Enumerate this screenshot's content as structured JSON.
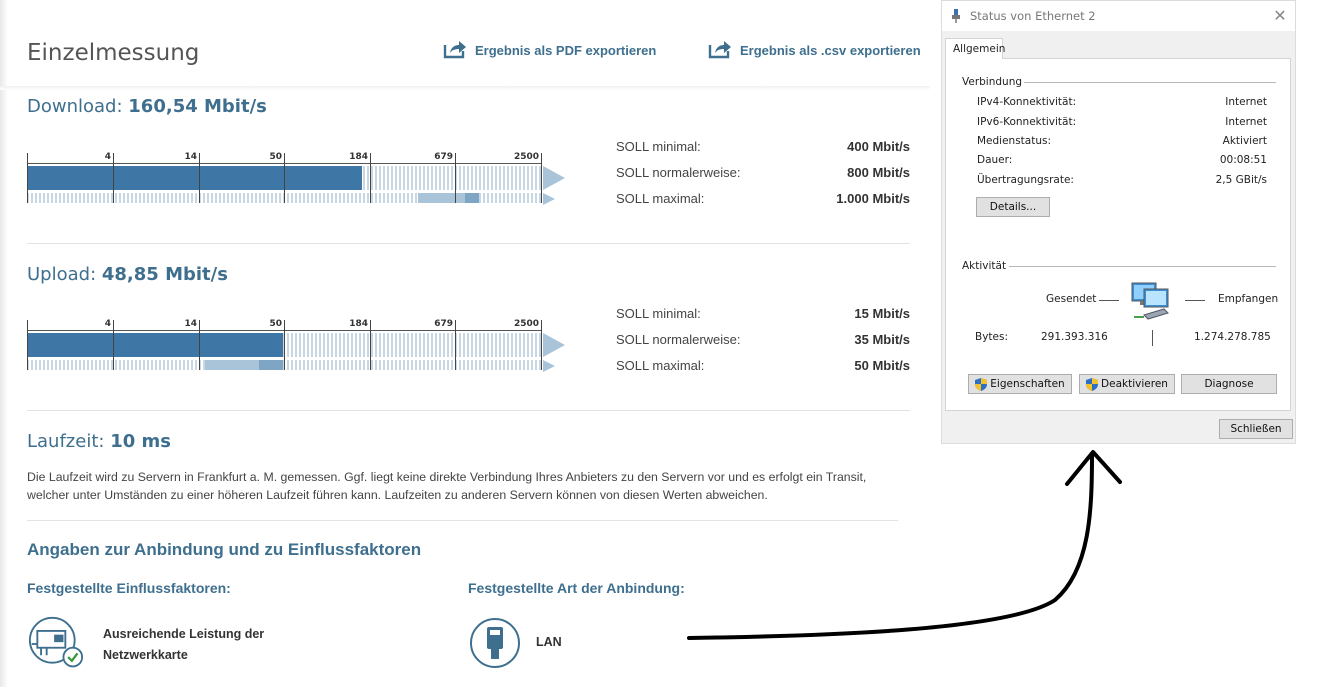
{
  "header": {
    "title": "Einzelmessung",
    "export_pdf": "Ergebnis als PDF exportieren",
    "export_csv": "Ergebnis als .csv exportieren"
  },
  "scale_labels": [
    "4",
    "14",
    "50",
    "184",
    "679",
    "2500"
  ],
  "download": {
    "label": "Download:",
    "value": "160,54 Mbit/s",
    "soll": [
      {
        "label": "SOLL minimal:",
        "value": "400 Mbit/s"
      },
      {
        "label": "SOLL normalerweise:",
        "value": "800 Mbit/s"
      },
      {
        "label": "SOLL maximal:",
        "value": "1.000 Mbit/s"
      }
    ]
  },
  "upload": {
    "label": "Upload:",
    "value": "48,85 Mbit/s",
    "soll": [
      {
        "label": "SOLL minimal:",
        "value": "15 Mbit/s"
      },
      {
        "label": "SOLL normalerweise:",
        "value": "35 Mbit/s"
      },
      {
        "label": "SOLL maximal:",
        "value": "50 Mbit/s"
      }
    ]
  },
  "latency": {
    "label": "Laufzeit:",
    "value": "10 ms",
    "description": "Die Laufzeit wird zu Servern in Frankfurt a. M. gemessen. Ggf. liegt keine direkte Verbindung Ihres Anbieters zu den Servern vor und es erfolgt ein Transit, welcher unter Umständen zu einer höheren Laufzeit führen kann. Laufzeiten zu anderen Servern können von diesen Werten abweichen."
  },
  "connection": {
    "heading": "Angaben zur Anbindung und zu Einflussfaktoren",
    "factors_heading": "Festgestellte Einflussfaktoren:",
    "factor_text": "Ausreichende Leistung der Netzwerkkarte",
    "type_heading": "Festgestellte Art der Anbindung:",
    "type_text": "LAN"
  },
  "dialog": {
    "title": "Status von Ethernet 2",
    "tab": "Allgemein",
    "group_connection": "Verbindung",
    "rows": [
      {
        "label": "IPv4-Konnektivität:",
        "value": "Internet"
      },
      {
        "label": "IPv6-Konnektivität:",
        "value": "Internet"
      },
      {
        "label": "Medienstatus:",
        "value": "Aktiviert"
      },
      {
        "label": "Dauer:",
        "value": "00:08:51"
      },
      {
        "label": "Übertragungsrate:",
        "value": "2,5 GBit/s"
      }
    ],
    "details_button": "Details...",
    "group_activity": "Aktivität",
    "sent_label": "Gesendet",
    "received_label": "Empfangen",
    "bytes_label": "Bytes:",
    "bytes_sent": "291.393.316",
    "bytes_received": "1.274.278.785",
    "btn_properties": "Eigenschaften",
    "btn_deactivate": "Deaktivieren",
    "btn_diagnose": "Diagnose",
    "btn_close": "Schließen"
  },
  "colors": {
    "accent": "#3e6f8e",
    "bar_fill": "#3e77a5",
    "bar_range": "#a9c3d9"
  }
}
